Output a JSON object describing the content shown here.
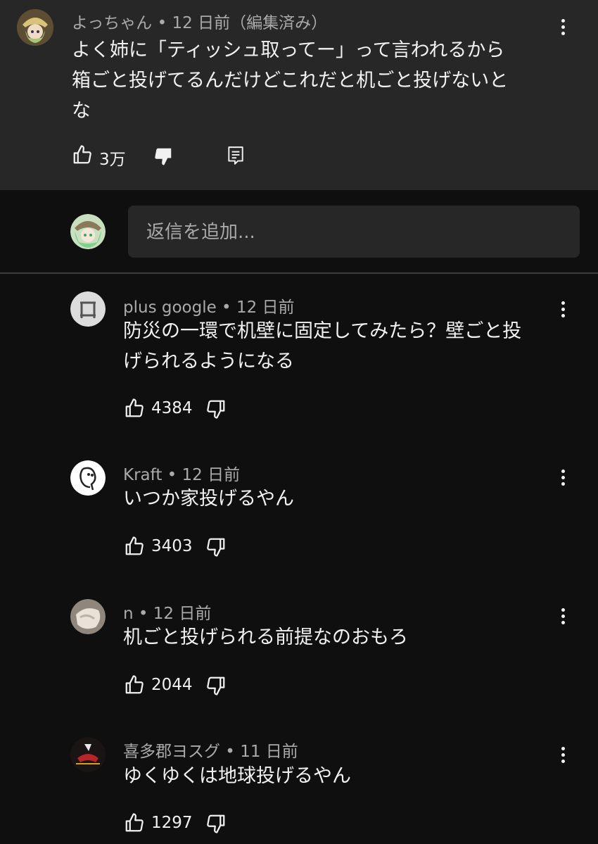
{
  "top_comment": {
    "author": "よっちゃん",
    "time": "12 日前（編集済み）",
    "text_lines": [
      "よく姉に「ティッシュ取ってー」って言われるから",
      "箱ごと投げてるんだけどこれだと机ごと投げないと",
      "な"
    ],
    "likes": "3万",
    "icons": [
      "like-icon",
      "dislike-filled-icon",
      "reply-comment-icon",
      "more-vert-icon"
    ]
  },
  "reply_input": {
    "placeholder": "返信を追加..."
  },
  "replies": [
    {
      "author": "plus google",
      "time": "12 日前",
      "text_lines": [
        "防災の一環で机壁に固定してみたら？壁ごと投",
        "げられるようになる"
      ],
      "likes": "4384"
    },
    {
      "author": "Kraft",
      "time": "12 日前",
      "text_lines": [
        "いつか家投げるやん"
      ],
      "likes": "3403"
    },
    {
      "author": "n",
      "time": "12 日前",
      "text_lines": [
        "机ごと投げられる前提なのおもろ"
      ],
      "likes": "2044"
    },
    {
      "author": "喜多郡ヨスグ",
      "time": "11 日前",
      "text_lines": [
        "ゆくゆくは地球投げるやん"
      ],
      "likes": "1297"
    }
  ],
  "colors": {
    "background": "#0f0f0f",
    "highlight": "#272727",
    "text": "#f1f1f1",
    "muted": "#aaaaaa"
  }
}
